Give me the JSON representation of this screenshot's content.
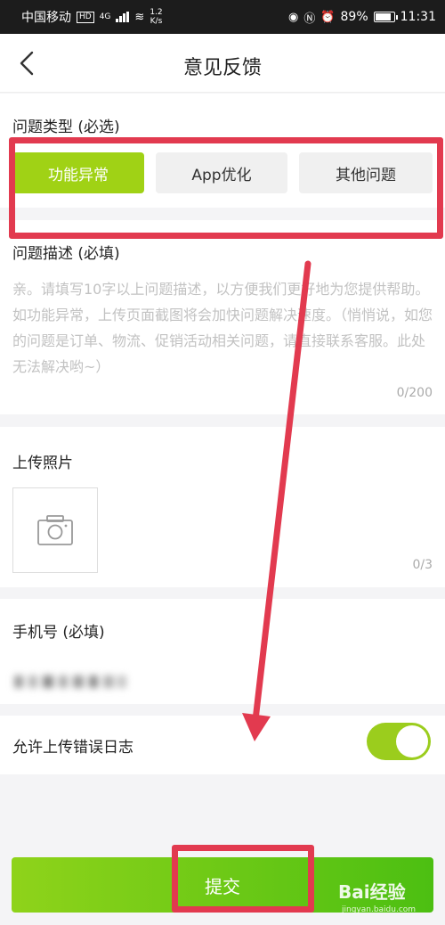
{
  "status_bar": {
    "carrier": "中国移动",
    "hd": "HD",
    "network": "4G",
    "speed_value": "1.2",
    "speed_unit": "K/s",
    "battery": "89%",
    "time": "11:31"
  },
  "header": {
    "title": "意见反馈"
  },
  "problem_type": {
    "label": "问题类型 (必选)",
    "options": [
      "功能异常",
      "App优化",
      "其他问题"
    ],
    "selected": "功能异常"
  },
  "description": {
    "label": "问题描述 (必填)",
    "placeholder": "亲。请填写10字以上问题描述，以方便我们更好地为您提供帮助。如功能异常，上传页面截图将会加快问题解决速度。（悄悄说，如您的问题是订单、物流、促销活动相关问题，请直接联系客服。此处无法解决哟~）",
    "count": "0/200"
  },
  "photo": {
    "label": "上传照片",
    "count": "0/3"
  },
  "phone": {
    "label": "手机号 (必填)"
  },
  "error_log": {
    "label": "允许上传错误日志",
    "enabled": true
  },
  "submit": {
    "label": "提交"
  },
  "watermark": {
    "brand": "Bai经验",
    "url": "jingyan.baidu.com"
  },
  "colors": {
    "accent": "#a0d215",
    "annotation": "#e23a4f"
  }
}
